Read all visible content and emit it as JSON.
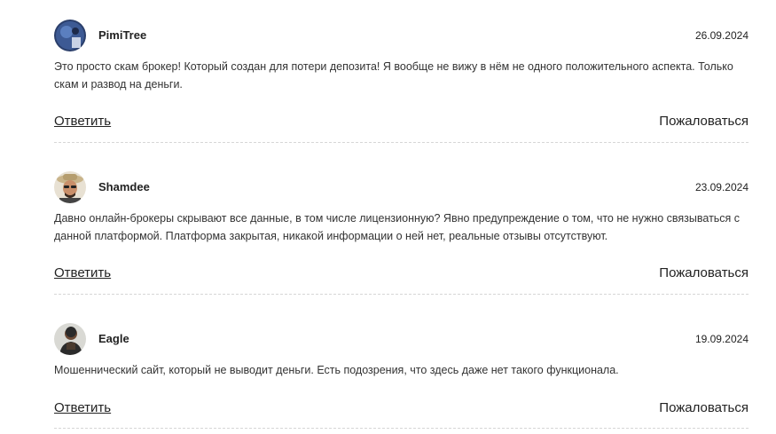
{
  "comments": [
    {
      "author": "PimiTree",
      "date": "26.09.2024",
      "text": "Это просто скам брокер! Который создан для потери депозита! Я вообще не вижу в нём не одного положительного аспекта. Только скам и развод на деньги.",
      "reply_label": "Ответить",
      "report_label": "Пожаловаться",
      "avatar": "avatar-blue-tree"
    },
    {
      "author": "Shamdee",
      "date": "23.09.2024",
      "text": "Давно онлайн-брокеры скрывают все данные, в том числе лицензионную? Явно предупреждение о том, что не нужно связываться с данной платформой. Платформа закрытая, никакой информации о ней нет, реальные отзывы отсутствуют.",
      "reply_label": "Ответить",
      "report_label": "Пожаловаться",
      "avatar": "avatar-man-hat-sunglasses"
    },
    {
      "author": "Eagle",
      "date": "19.09.2024",
      "text": "Мошеннический сайт, который не выводит деньги. Есть подозрения, что здесь даже нет такого функционала.",
      "reply_label": "Ответить",
      "report_label": "Пожаловаться",
      "avatar": "avatar-man-dark"
    }
  ]
}
